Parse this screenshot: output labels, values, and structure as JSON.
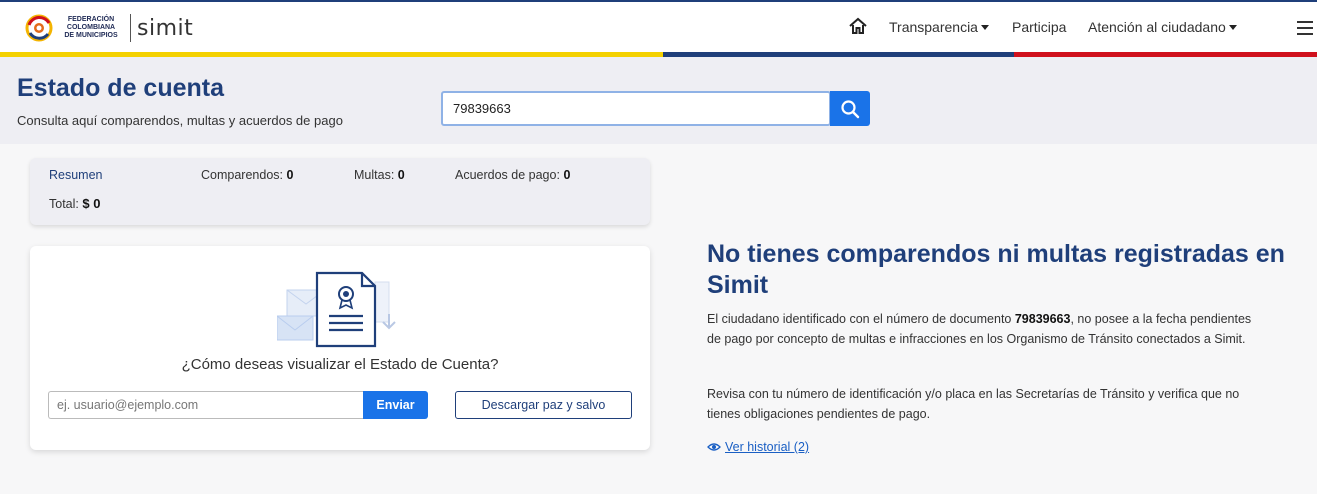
{
  "brand": {
    "federation_lines": [
      "FEDERACIÓN",
      "COLOMBIANA",
      "DE MUNICIPIOS"
    ],
    "product": "simit"
  },
  "nav": {
    "items": [
      {
        "label": "Transparencia",
        "dropdown": true
      },
      {
        "label": "Participa",
        "dropdown": false
      },
      {
        "label": "Atención al ciudadano",
        "dropdown": true
      }
    ],
    "home_icon": "home-icon",
    "menu_icon": "hamburger-icon"
  },
  "stripe_colors": {
    "yellow": "#f4d100",
    "blue": "#1f3f7a",
    "red": "#d0111d"
  },
  "header": {
    "title": "Estado de cuenta",
    "subtitle": "Consulta aquí comparendos, multas y acuerdos de pago",
    "search_value": "79839663",
    "search_icon": "search-icon"
  },
  "summary": {
    "resumen_label": "Resumen",
    "comparendos_label": "Comparendos:",
    "comparendos_value": "0",
    "multas_label": "Multas:",
    "multas_value": "0",
    "acuerdos_label": "Acuerdos de pago:",
    "acuerdos_value": "0",
    "total_label": "Total:",
    "total_value": "$ 0"
  },
  "card": {
    "question": "¿Cómo deseas visualizar el Estado de Cuenta?",
    "email_placeholder": "ej. usuario@ejemplo.com",
    "send_label": "Enviar",
    "download_label": "Descargar paz y salvo"
  },
  "result": {
    "title": "No tienes comparendos ni multas registradas en Simit",
    "p1_before": "El ciudadano identificado con el número de documento ",
    "p1_doc": "79839663",
    "p1_after": ", no posee a la fecha pendientes de pago por concepto de multas e infracciones en los Organismo de Tránsito conectados a Simit.",
    "p2": "Revisa con tu número de identificación y/o placa en las Secretarías de Tránsito y verifica que no tienes obligaciones pendientes de pago.",
    "history_link": "Ver historial (2)",
    "history_icon": "eye-icon"
  },
  "colors": {
    "primary": "#1f3f7a",
    "accent": "#1a73e8"
  }
}
